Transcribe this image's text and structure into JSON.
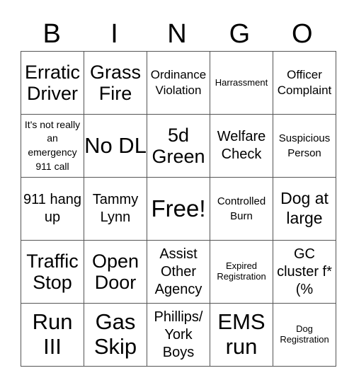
{
  "header": {
    "letters": [
      "B",
      "I",
      "N",
      "G",
      "O"
    ]
  },
  "grid": {
    "rows": [
      [
        "Erratic Driver",
        "Grass Fire",
        "Ordinance Violation",
        "Harrassment",
        "Officer Complaint"
      ],
      [
        "It's not really an emergency 911 call",
        "No DL",
        "5d Green",
        "Welfare Check",
        "Suspicious Person"
      ],
      [
        "911 hang up",
        "Tammy Lynn",
        "Free!",
        "Controlled Burn",
        "Dog at large"
      ],
      [
        "Traffic Stop",
        "Open Door",
        "Assist Other Agency",
        "Expired Registration",
        "GC cluster f*(%"
      ],
      [
        "Run III",
        "Gas Skip",
        "Phillips/ York Boys",
        "EMS run",
        "Dog Registration"
      ]
    ]
  }
}
